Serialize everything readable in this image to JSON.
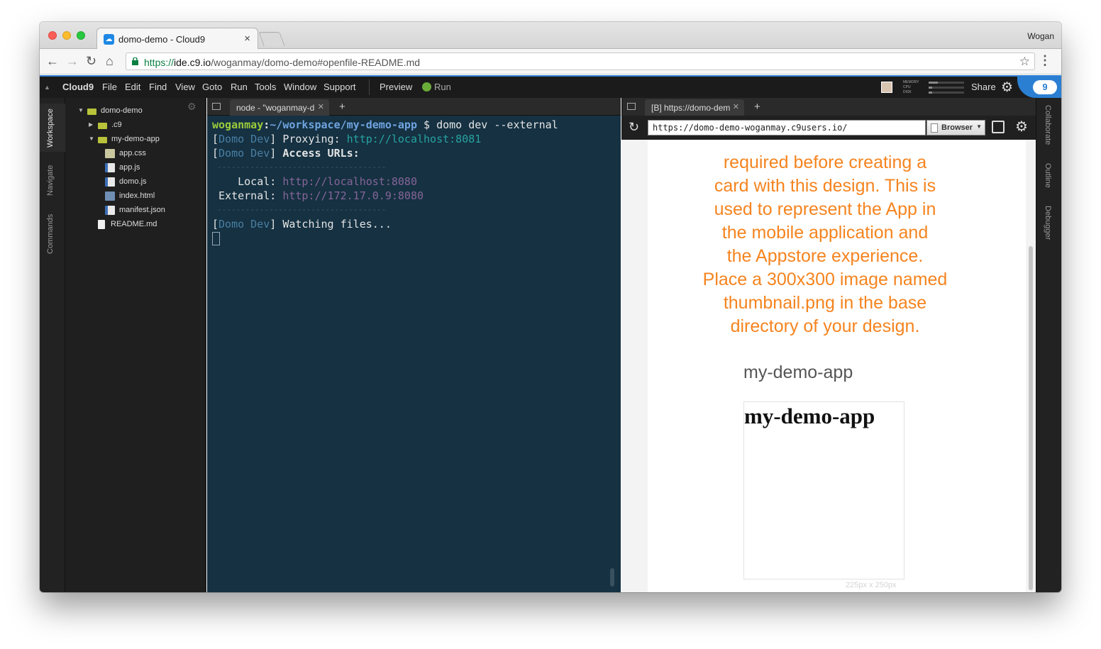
{
  "browser": {
    "tab_title": "domo-demo - Cloud9",
    "tab_close": "×",
    "profile_name": "Wogan",
    "url_scheme": "https://",
    "url_host": "ide.c9.io",
    "url_path": "/woganmay/domo-demo#openfile-README.md"
  },
  "c9": {
    "brand": "Cloud9",
    "menus": [
      "File",
      "Edit",
      "Find",
      "View",
      "Goto",
      "Run",
      "Tools",
      "Window",
      "Support"
    ],
    "preview": "Preview",
    "run": "Run",
    "meters": [
      "MEMORY",
      "CPU",
      "DISK"
    ],
    "meter_levels": [
      0.25,
      0.1,
      0.1
    ],
    "share": "Share",
    "badge": "9"
  },
  "left_panel_tabs": [
    "Workspace",
    "Navigate",
    "Commands"
  ],
  "right_panel_tabs": [
    "Collaborate",
    "Outline",
    "Debugger"
  ],
  "file_tree": [
    {
      "label": "domo-demo",
      "type": "folder",
      "expanded": true,
      "depth": 0
    },
    {
      "label": ".c9",
      "type": "folder",
      "expanded": false,
      "depth": 1
    },
    {
      "label": "my-demo-app",
      "type": "folder",
      "expanded": true,
      "depth": 1
    },
    {
      "label": "app.css",
      "type": "css",
      "depth": 2
    },
    {
      "label": "app.js",
      "type": "js",
      "depth": 2
    },
    {
      "label": "domo.js",
      "type": "js",
      "depth": 2
    },
    {
      "label": "index.html",
      "type": "html",
      "depth": 2
    },
    {
      "label": "manifest.json",
      "type": "json",
      "depth": 2
    },
    {
      "label": "README.md",
      "type": "md",
      "depth": 1
    }
  ],
  "terminal": {
    "tab_title": "node - \"woganmay-d",
    "prompt_user": "woganmay",
    "prompt_path": "~/workspace/my-demo-app",
    "command": "$ domo dev --external",
    "tag": "Domo Dev",
    "proxying_label": "Proxying:",
    "proxying_url": "http://localhost:8081",
    "access_label": "Access URLs:",
    "rule": "------------------------------------",
    "local_label": "Local:",
    "local_url": "http://localhost:8080",
    "external_label": "External:",
    "external_url": "http://172.17.0.9:8080",
    "watching": "Watching files..."
  },
  "preview_pane": {
    "tab_title": "[B] https://domo-dem",
    "url": "https://domo-demo-woganmay.c9users.io/",
    "mode": "Browser",
    "orange_lines": [
      "required before creating a",
      "card with this design. This is",
      "used to represent the App in",
      "the mobile application and",
      "the Appstore experience.",
      "Place a 300x300 image named",
      "thumbnail.png in the base",
      "directory of your design."
    ],
    "card_title": "my-demo-app",
    "card_heading": "my-demo-app",
    "card_size": "225px x 250px"
  },
  "colors": {
    "accent": "#2f7fd3",
    "terminal_bg": "#153142",
    "orange": "#f5841f"
  }
}
